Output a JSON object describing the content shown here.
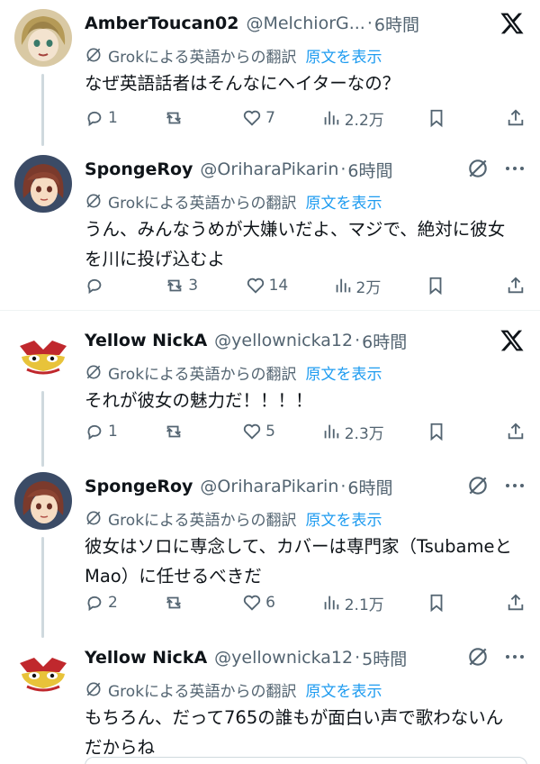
{
  "translate": {
    "label": "Grokによる英語からの翻訳",
    "show_original": "原文を表示"
  },
  "tweets": [
    {
      "name": "AmberToucan02",
      "handle": "@MelchiorG...",
      "sep": "·",
      "time": "6時間",
      "text": "なぜ英語話者はそんなにヘイターなの？",
      "reply": "1",
      "retweet": "",
      "like": "7",
      "views": "2.2万",
      "corner": "x-logo-icon"
    },
    {
      "name": "SpongeRoy",
      "handle": "@OriharaPikarin",
      "sep": "·",
      "time": "6時間",
      "text": "うん、みんなうめが大嫌いだよ、マジで、絶対に彼女を川に投げ込むよ",
      "reply": "",
      "retweet": "3",
      "like": "14",
      "views": "2万",
      "corner": "grok-icon"
    },
    {
      "name": "Yellow NickA",
      "handle": "@yellownicka12",
      "sep": "·",
      "time": "6時間",
      "text": "それが彼女の魅力だ！！！！",
      "reply": "1",
      "retweet": "",
      "like": "5",
      "views": "2.3万",
      "corner": "x-logo-icon"
    },
    {
      "name": "SpongeRoy",
      "handle": "@OriharaPikarin",
      "sep": "·",
      "time": "6時間",
      "text": "彼女はソロに専念して、カバーは専門家（TsubameとMao）に任せるべきだ",
      "reply": "2",
      "retweet": "",
      "like": "6",
      "views": "2.1万",
      "corner": "grok-icon"
    },
    {
      "name": "Yellow NickA",
      "handle": "@yellownicka12",
      "sep": "·",
      "time": "5時間",
      "text": "もちろん、だって765の誰もが面白い声で歌わないんだからね",
      "corner": "grok-icon"
    }
  ]
}
